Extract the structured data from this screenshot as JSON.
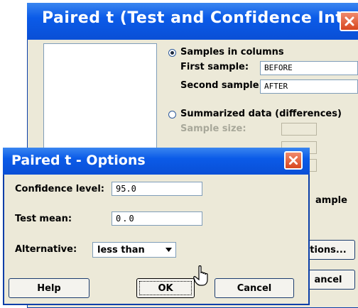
{
  "main_dialog": {
    "title": "Paired t (Test and Confidence Inte...",
    "samples_in_columns_label": "Samples in columns",
    "first_sample_label": "First sample:",
    "first_sample_value": "BEFORE",
    "second_sample_label": "Second sample:",
    "second_sample_value": "AFTER",
    "summarized_label": "Summarized data (differences)",
    "sample_size_label": "Sample size:",
    "partial_label": "ample",
    "options_button": "tions...",
    "cancel_button": "ancel"
  },
  "options_dialog": {
    "title": "Paired t - Options",
    "confidence_label": "Confidence level:",
    "confidence_value": "95.0",
    "test_mean_label": "Test mean:",
    "test_mean_value": "0.0",
    "alternative_label": "Alternative:",
    "alternative_value": "less than",
    "help_button": "Help",
    "ok_button": "OK",
    "cancel_button": "Cancel"
  }
}
